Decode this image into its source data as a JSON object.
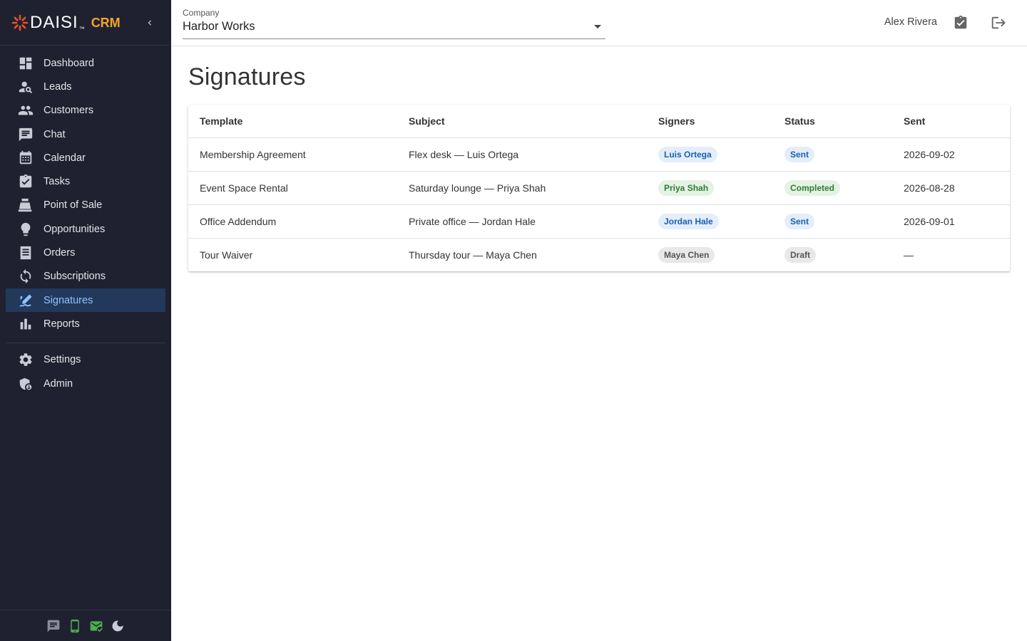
{
  "brand": {
    "name": "DAISI",
    "tm": "™",
    "product": "CRM"
  },
  "sidebar": {
    "items": [
      {
        "label": "Dashboard",
        "icon": "dashboard-icon"
      },
      {
        "label": "Leads",
        "icon": "person-search-icon"
      },
      {
        "label": "Customers",
        "icon": "people-icon"
      },
      {
        "label": "Chat",
        "icon": "chat-icon"
      },
      {
        "label": "Calendar",
        "icon": "calendar-icon"
      },
      {
        "label": "Tasks",
        "icon": "clipboard-check-icon"
      },
      {
        "label": "Point of Sale",
        "icon": "cash-register-icon"
      },
      {
        "label": "Opportunities",
        "icon": "lightbulb-icon"
      },
      {
        "label": "Orders",
        "icon": "receipt-icon"
      },
      {
        "label": "Subscriptions",
        "icon": "refresh-icon"
      },
      {
        "label": "Signatures",
        "icon": "signature-icon",
        "active": true
      },
      {
        "label": "Reports",
        "icon": "bar-chart-icon"
      }
    ],
    "secondary": [
      {
        "label": "Settings",
        "icon": "gear-icon"
      },
      {
        "label": "Admin",
        "icon": "admin-shield-icon"
      }
    ]
  },
  "topbar": {
    "company_label": "Company",
    "company_value": "Harbor Works",
    "user_name": "Alex Rivera"
  },
  "page": {
    "title": "Signatures"
  },
  "table": {
    "headers": {
      "template": "Template",
      "subject": "Subject",
      "signers": "Signers",
      "status": "Status",
      "sent": "Sent"
    },
    "rows": [
      {
        "template": "Membership Agreement",
        "subject": "Flex desk — Luis Ortega",
        "signer": "Luis Ortega",
        "status": "Sent",
        "sent": "2026-09-02"
      },
      {
        "template": "Event Space Rental",
        "subject": "Saturday lounge — Priya Shah",
        "signer": "Priya Shah",
        "status": "Completed",
        "sent": "2026-08-28"
      },
      {
        "template": "Office Addendum",
        "subject": "Private office — Jordan Hale",
        "signer": "Jordan Hale",
        "status": "Sent",
        "sent": "2026-09-01"
      },
      {
        "template": "Tour Waiver",
        "subject": "Thursday tour — Maya Chen",
        "signer": "Maya Chen",
        "status": "Draft",
        "sent": "—"
      }
    ]
  },
  "colors": {
    "sidebar_bg": "#1f2130",
    "active_bg": "#23395b",
    "active_text": "#8ec3ff",
    "brand_accent": "#f5a623",
    "logo_orange": "#e8532a",
    "status_green": "#4caf50"
  }
}
